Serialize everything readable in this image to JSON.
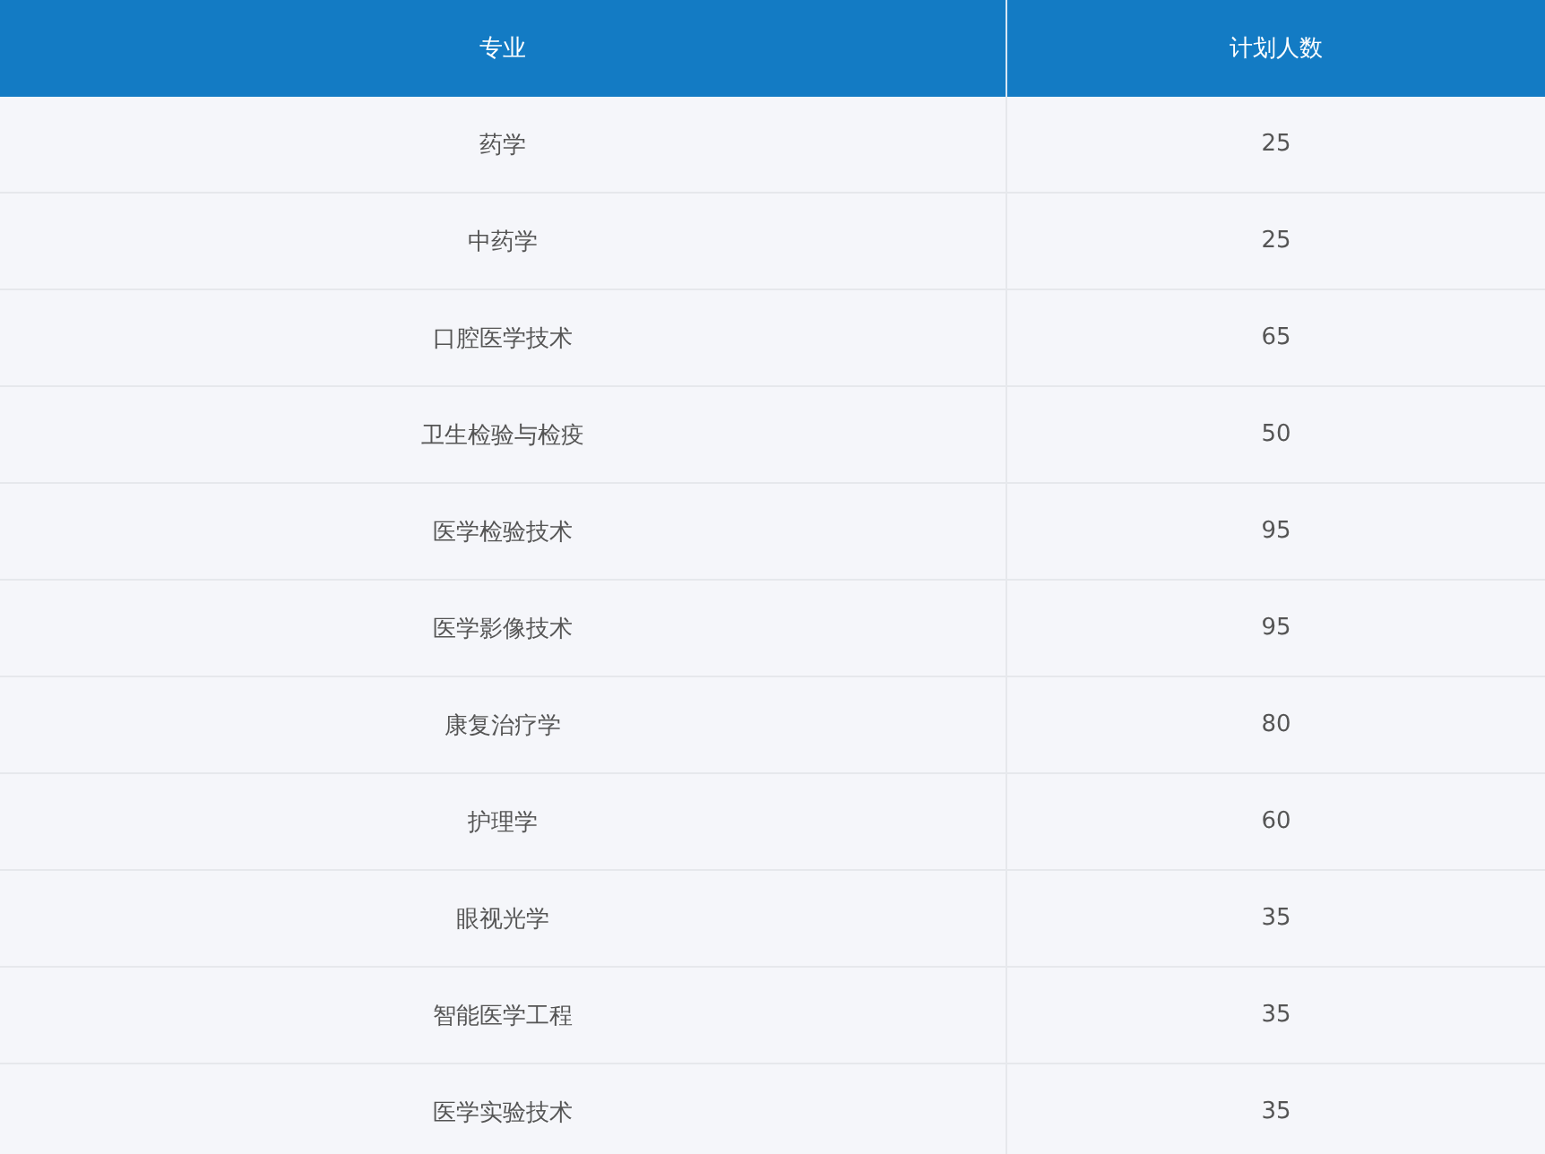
{
  "table": {
    "columns": [
      "专业",
      "计划人数"
    ],
    "rows": [
      [
        "药学",
        "25"
      ],
      [
        "中药学",
        "25"
      ],
      [
        "口腔医学技术",
        "65"
      ],
      [
        "卫生检验与检疫",
        "50"
      ],
      [
        "医学检验技术",
        "95"
      ],
      [
        "医学影像技术",
        "95"
      ],
      [
        "康复治疗学",
        "80"
      ],
      [
        "护理学",
        "60"
      ],
      [
        "眼视光学",
        "35"
      ],
      [
        "智能医学工程",
        "35"
      ],
      [
        "医学实验技术",
        "35"
      ]
    ]
  }
}
